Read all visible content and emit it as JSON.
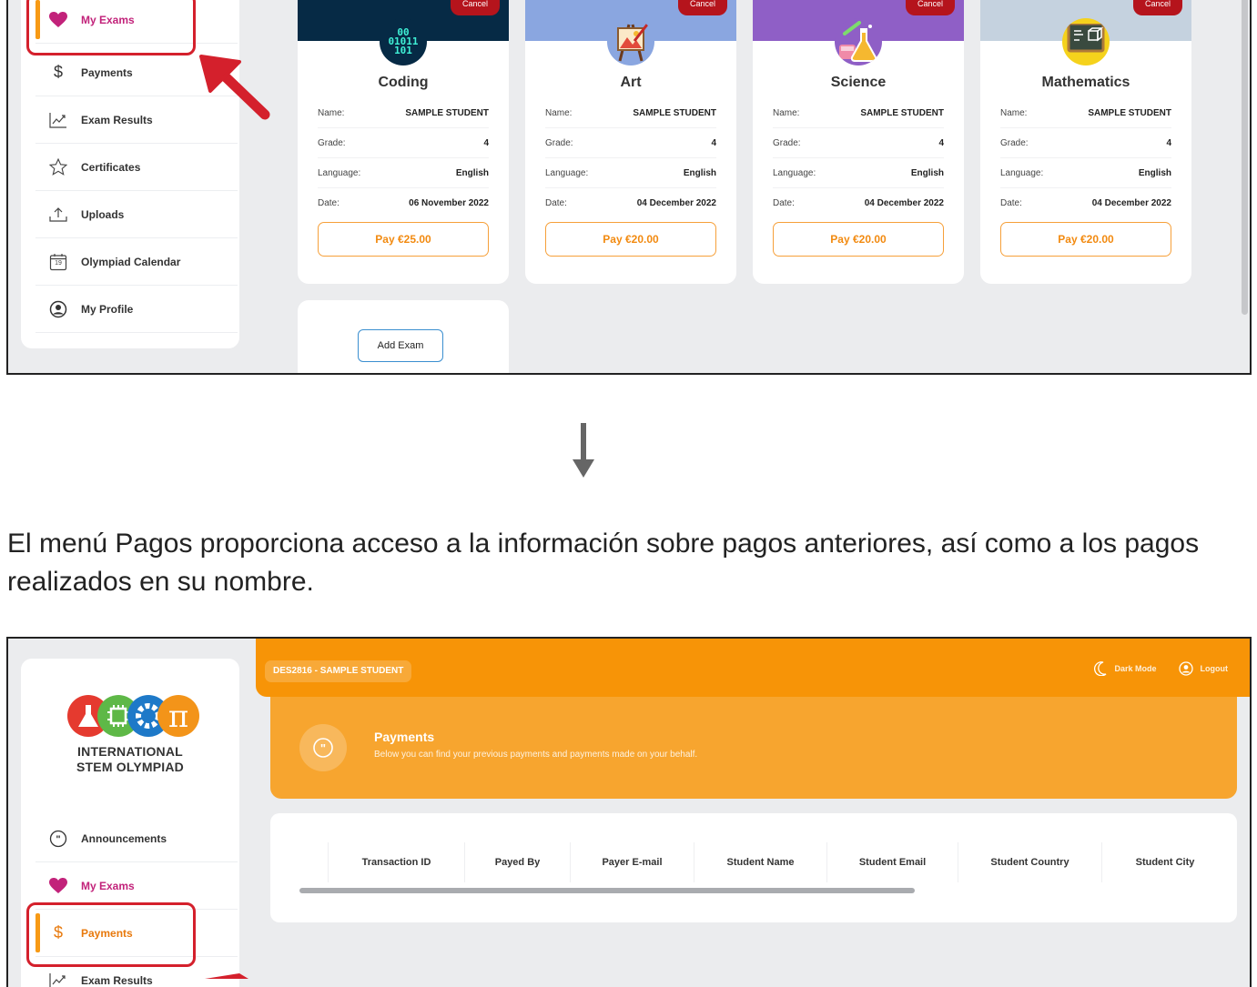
{
  "top_screenshot": {
    "sidebar": {
      "items": [
        {
          "label": "My Exams",
          "icon": "heart-icon"
        },
        {
          "label": "Payments",
          "icon": "dollar-icon"
        },
        {
          "label": "Exam Results",
          "icon": "chart-icon"
        },
        {
          "label": "Certificates",
          "icon": "star-icon"
        },
        {
          "label": "Uploads",
          "icon": "upload-icon"
        },
        {
          "label": "Olympiad Calendar",
          "icon": "calendar-icon"
        },
        {
          "label": "My Profile",
          "icon": "profile-icon"
        }
      ],
      "calendar_day": "19"
    },
    "exams": [
      {
        "subject": "Coding",
        "name": "SAMPLE STUDENT",
        "grade": "4",
        "language": "English",
        "date": "06 November 2022",
        "pay": "Pay €25.00",
        "header_color": "#062a45"
      },
      {
        "subject": "Art",
        "name": "SAMPLE STUDENT",
        "grade": "4",
        "language": "English",
        "date": "04 December 2022",
        "pay": "Pay €20.00",
        "header_color": "#8aa6e0"
      },
      {
        "subject": "Science",
        "name": "SAMPLE STUDENT",
        "grade": "4",
        "language": "English",
        "date": "04 December 2022",
        "pay": "Pay €20.00",
        "header_color": "#8f5fc6"
      },
      {
        "subject": "Mathematics",
        "name": "SAMPLE STUDENT",
        "grade": "4",
        "language": "English",
        "date": "04 December 2022",
        "pay": "Pay €20.00",
        "header_color": "#c5d2df"
      }
    ],
    "labels": {
      "cancel": "Cancel",
      "name": "Name:",
      "grade": "Grade:",
      "language": "Language:",
      "date": "Date:",
      "add_exam": "Add Exam"
    },
    "coding_icon_text": [
      "00",
      "01011",
      "101"
    ]
  },
  "caption": "El menú Pagos proporciona acceso a la información sobre pagos anteriores, así como a los pagos realizados en su nombre.",
  "bottom_screenshot": {
    "logo_text_line1": "INTERNATIONAL",
    "logo_text_line2": "STEM OLYMPIAD",
    "logo_pi": "π",
    "topbar": {
      "student": "DES2816 - SAMPLE STUDENT",
      "dark_mode": "Dark Mode",
      "logout": "Logout"
    },
    "banner": {
      "title": "Payments",
      "subtitle": "Below you can find your previous payments and payments made on your behalf."
    },
    "sidebar": {
      "items": [
        {
          "label": "Announcements",
          "icon": "chat-bubble-icon"
        },
        {
          "label": "My Exams",
          "icon": "heart-icon"
        },
        {
          "label": "Payments",
          "icon": "dollar-icon"
        },
        {
          "label": "Exam Results",
          "icon": "chart-icon"
        }
      ]
    },
    "table": {
      "columns": [
        "Transaction ID",
        "Payed By",
        "Payer E-mail",
        "Student Name",
        "Student Email",
        "Student Country",
        "Student City"
      ]
    }
  },
  "colors": {
    "accent_orange": "#f79407",
    "highlight_red": "#d4202c",
    "pink": "#c2227a"
  }
}
